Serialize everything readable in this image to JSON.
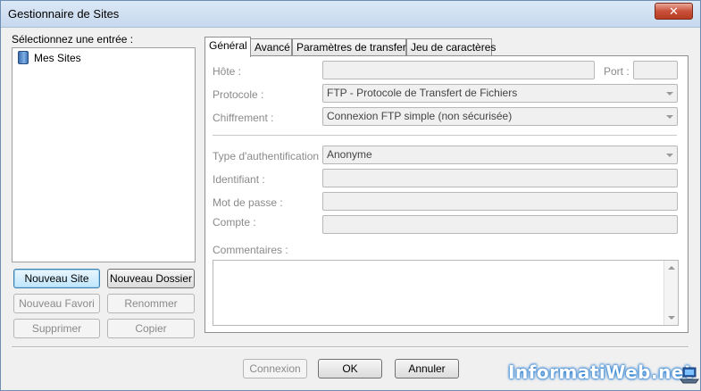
{
  "window": {
    "title": "Gestionnaire de Sites",
    "close_label": "✕"
  },
  "left": {
    "select_label": "Sélectionnez une entrée :",
    "tree_root": "Mes Sites",
    "buttons": {
      "new_site": "Nouveau Site",
      "new_folder": "Nouveau Dossier",
      "new_bookmark": "Nouveau Favori",
      "rename": "Renommer",
      "delete": "Supprimer",
      "copy": "Copier"
    }
  },
  "tabs": [
    "Général",
    "Avancé",
    "Paramètres de transfert",
    "Jeu de caractères"
  ],
  "general": {
    "host_label": "Hôte :",
    "host_value": "",
    "port_label": "Port :",
    "port_value": "",
    "protocol_label": "Protocole :",
    "protocol_value": "FTP - Protocole de Transfert de Fichiers",
    "encryption_label": "Chiffrement :",
    "encryption_value": "Connexion FTP simple (non sécurisée)",
    "auth_label": "Type d'authentification :",
    "auth_value": "Anonyme",
    "user_label": "Identifiant :",
    "user_value": "",
    "password_label": "Mot de passe :",
    "password_value": "",
    "account_label": "Compte :",
    "account_value": "",
    "comments_label": "Commentaires :",
    "comments_value": ""
  },
  "footer": {
    "connect": "Connexion",
    "ok": "OK",
    "cancel": "Annuler"
  },
  "watermark": {
    "text": "InformatiWeb.net",
    "glow_color": "#2a7fd0"
  }
}
